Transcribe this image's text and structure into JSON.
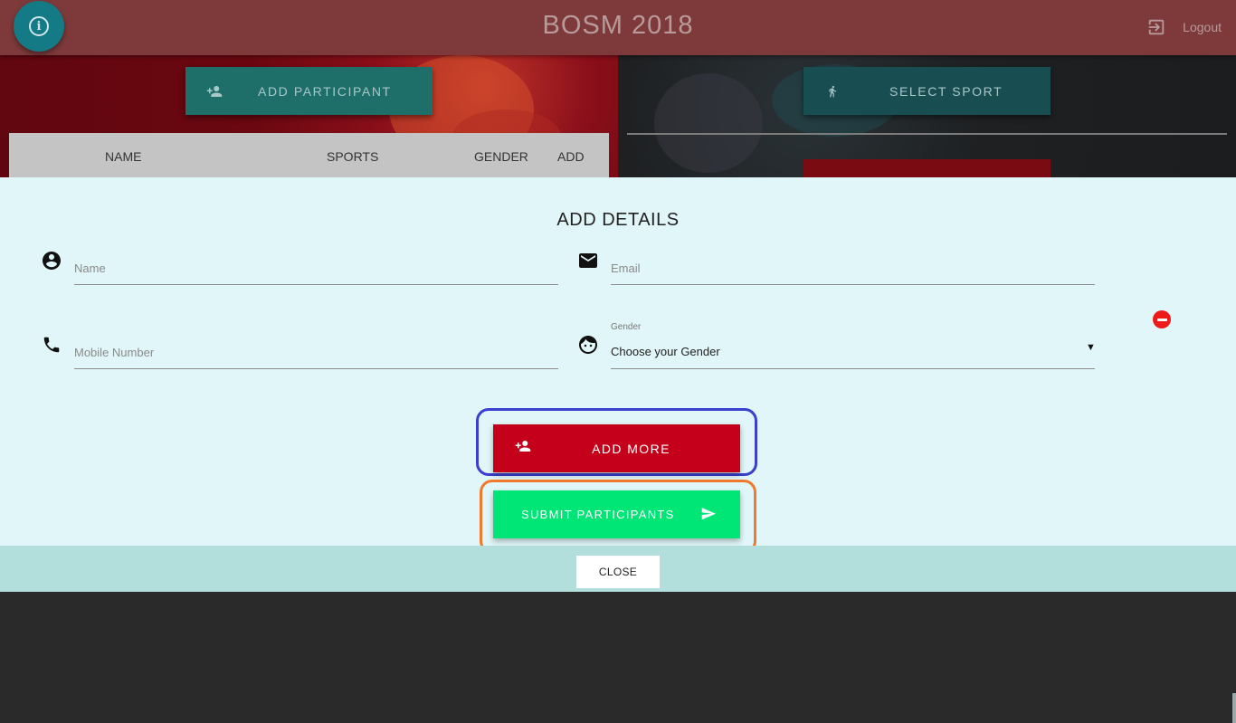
{
  "header": {
    "title": "BOSM 2018",
    "logout_label": "Logout"
  },
  "background": {
    "add_participant_label": "ADD PARTICIPANT",
    "select_sport_label": "SELECT SPORT",
    "table_columns": [
      "NAME",
      "SPORTS",
      "GENDER",
      "ADD"
    ]
  },
  "modal": {
    "title": "ADD DETAILS",
    "name_placeholder": "Name",
    "email_placeholder": "Email",
    "mobile_placeholder": "Mobile Number",
    "gender_label": "Gender",
    "gender_value": "Choose your Gender",
    "add_more_label": "ADD MORE",
    "submit_label": "SUBMIT PARTICIPANTS"
  },
  "footer": {
    "close_label": "CLOSE"
  },
  "colors": {
    "header": "#7e3a3a",
    "add_more": "#c4001b",
    "submit": "#00e676",
    "modal_bg": "#e1f6f8",
    "footer_bg": "#b2dfdb",
    "highlight_blue": "#3a3fcf",
    "highlight_orange": "#f07a2c"
  },
  "icons": [
    "info-icon",
    "logout-icon",
    "add-person-icon",
    "run-icon",
    "account-circle-icon",
    "mail-icon",
    "phone-icon",
    "face-icon",
    "remove-circle-icon",
    "send-icon"
  ]
}
